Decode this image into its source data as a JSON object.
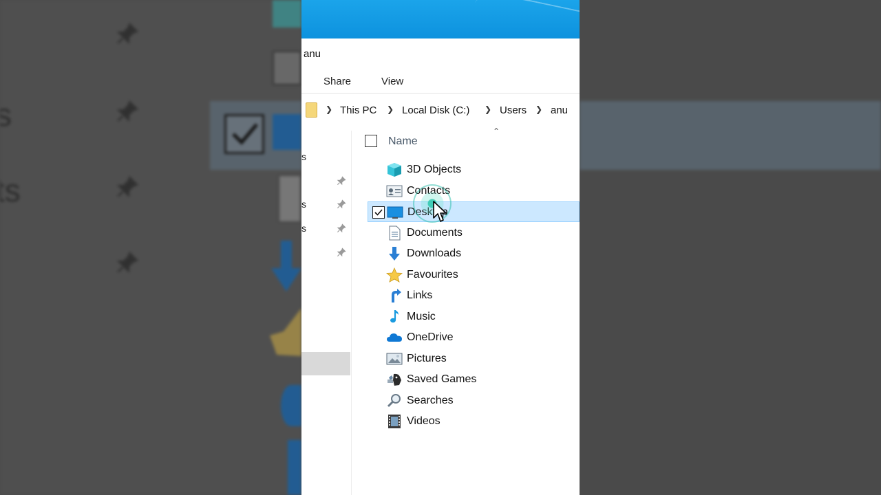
{
  "window": {
    "title": "anu",
    "ribbon_tabs": [
      "Share",
      "View"
    ]
  },
  "breadcrumb": [
    "This PC",
    "Local Disk (C:)",
    "Users",
    "anu"
  ],
  "navpane_fragments": [
    "s",
    "s",
    "s"
  ],
  "column_header": {
    "name": "Name"
  },
  "items": [
    {
      "name": "3D Objects",
      "icon": "3d-objects-icon",
      "selected": false
    },
    {
      "name": "Contacts",
      "icon": "contacts-icon",
      "selected": false
    },
    {
      "name": "Desktop",
      "icon": "desktop-icon",
      "selected": true
    },
    {
      "name": "Documents",
      "icon": "documents-icon",
      "selected": false
    },
    {
      "name": "Downloads",
      "icon": "downloads-icon",
      "selected": false
    },
    {
      "name": "Favourites",
      "icon": "favourites-icon",
      "selected": false
    },
    {
      "name": "Links",
      "icon": "links-icon",
      "selected": false
    },
    {
      "name": "Music",
      "icon": "music-icon",
      "selected": false
    },
    {
      "name": "OneDrive",
      "icon": "onedrive-icon",
      "selected": false
    },
    {
      "name": "Pictures",
      "icon": "pictures-icon",
      "selected": false
    },
    {
      "name": "Saved Games",
      "icon": "saved-games-icon",
      "selected": false
    },
    {
      "name": "Searches",
      "icon": "searches-icon",
      "selected": false
    },
    {
      "name": "Videos",
      "icon": "videos-icon",
      "selected": false
    }
  ],
  "background_fragments": {
    "left_a": "s",
    "left_b": "ts"
  },
  "colors": {
    "titlebar": "#0d92de",
    "selection": "#cce8ff",
    "selection_border": "#99d1ff"
  }
}
